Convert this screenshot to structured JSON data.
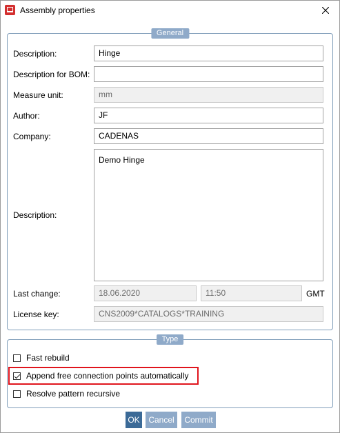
{
  "window": {
    "title": "Assembly properties"
  },
  "general": {
    "legend": "General",
    "description_label": "Description:",
    "description_value": "Hinge",
    "bom_label": "Description for BOM:",
    "bom_value": "",
    "measure_label": "Measure unit:",
    "measure_value": "mm",
    "author_label": "Author:",
    "author_value": "JF",
    "company_label": "Company:",
    "company_value": "CADENAS",
    "long_description_label": "Description:",
    "long_description_value": "Demo Hinge",
    "last_change_label": "Last change:",
    "last_change_date": "18.06.2020",
    "last_change_time": "11:50",
    "timezone": "GMT",
    "license_label": "License key:",
    "license_value": "CNS2009*CATALOGS*TRAINING"
  },
  "type": {
    "legend": "Type",
    "options": [
      {
        "label": "Fast rebuild",
        "checked": false
      },
      {
        "label": "Append free connection points automatically",
        "checked": true
      },
      {
        "label": "Resolve pattern recursive",
        "checked": false
      }
    ]
  },
  "buttons": {
    "ok": "OK",
    "cancel": "Cancel",
    "commit": "Commit"
  },
  "colors": {
    "accent": "#8faac9",
    "primary": "#3b6a97",
    "highlight": "#e0141c"
  }
}
